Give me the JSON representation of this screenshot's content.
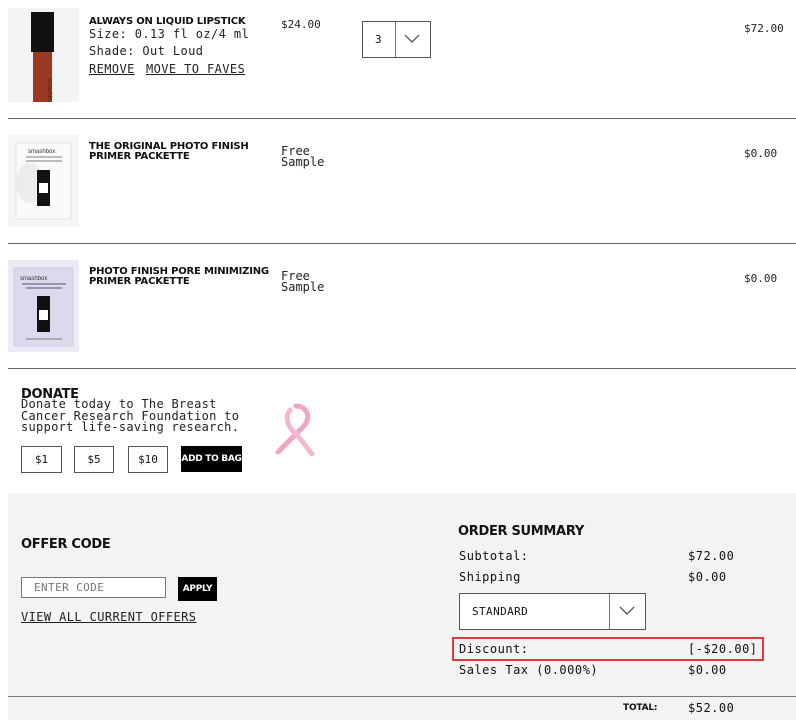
{
  "items": [
    {
      "name": "ALWAYS ON LIQUID LIPSTICK",
      "size": "Size: 0.13 fl oz/4 ml",
      "shade": "Shade: Out Loud",
      "remove": "REMOVE",
      "move_to_faves": "MOVE TO FAVES",
      "price": "$24.00",
      "quantity": "3",
      "total": "$72.00"
    },
    {
      "name": "THE ORIGINAL PHOTO FINISH PRIMER PACKETTE",
      "price_line1": "Free",
      "price_line2": "Sample",
      "total": "$0.00"
    },
    {
      "name": "PHOTO FINISH PORE MINIMIZING PRIMER PACKETTE",
      "price_line1": "Free",
      "price_line2": "Sample",
      "total": "$0.00"
    }
  ],
  "donate": {
    "title": "DONATE",
    "text": "Donate today to The Breast Cancer Research Foundation to support life-saving research.",
    "amounts": [
      "$1",
      "$5",
      "$10"
    ],
    "add_label": "ADD TO BAG"
  },
  "offer": {
    "title": "OFFER CODE",
    "placeholder": "ENTER CODE",
    "apply_label": "APPLY",
    "view_all": "VIEW ALL CURRENT OFFERS"
  },
  "summary": {
    "title": "ORDER SUMMARY",
    "subtotal_label": "Subtotal:",
    "subtotal_value": "$72.00",
    "shipping_label": "Shipping",
    "shipping_value": "$0.00",
    "shipping_method": "STANDARD",
    "discount_label": "Discount:",
    "discount_value": "[-$20.00]",
    "tax_label": "Sales Tax (0.000%)",
    "tax_value": "$0.00",
    "total_label": "TOTAL:",
    "total_value": "$52.00"
  },
  "colors": {
    "highlight": "#e03a3a",
    "ribbon": "#f0a6c6",
    "lipstick": "#9b3a22"
  }
}
